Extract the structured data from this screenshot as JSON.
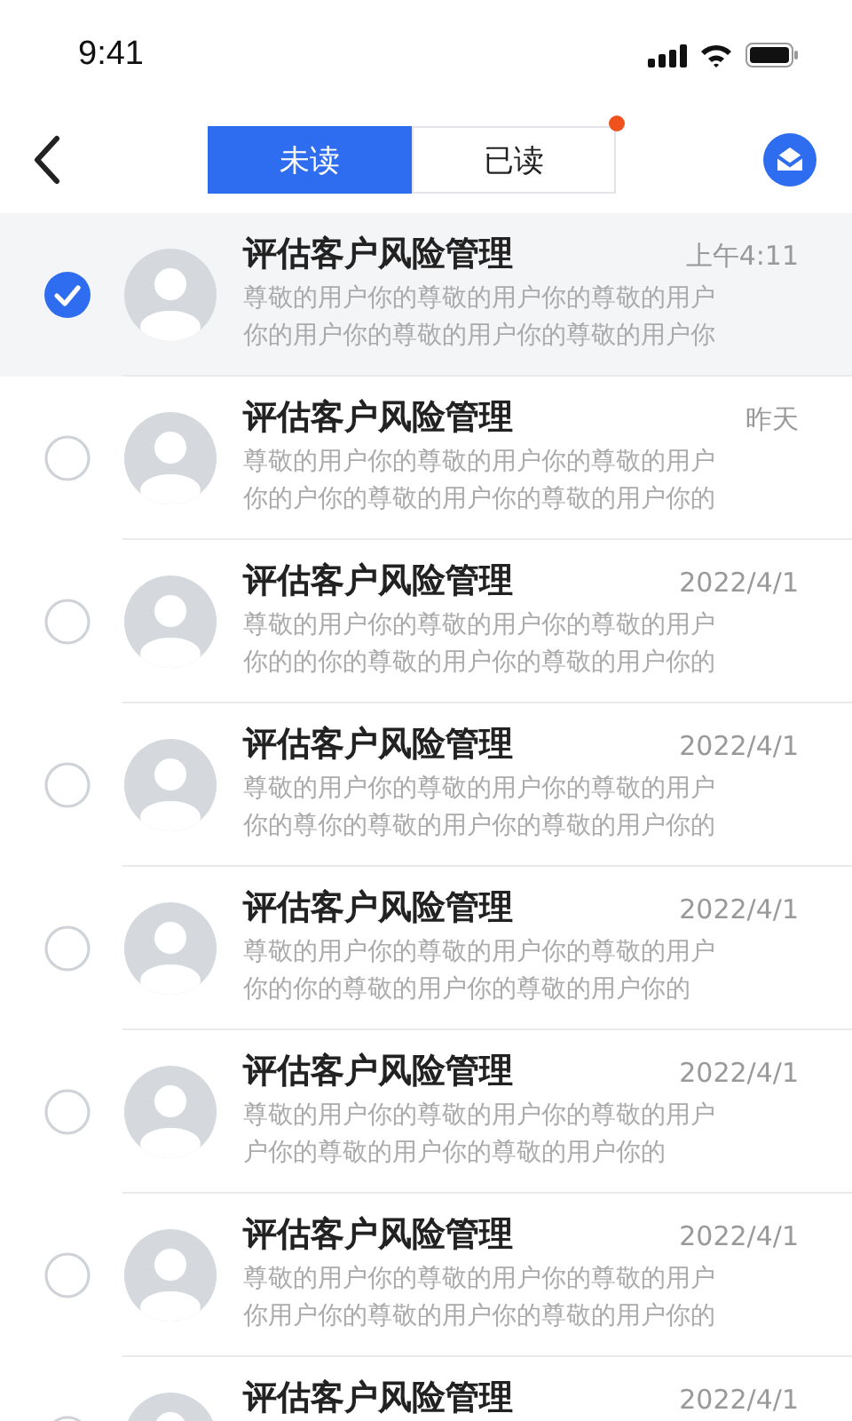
{
  "status_bar": {
    "time": "9:41"
  },
  "nav": {
    "tabs": [
      {
        "label": "未读",
        "selected": true,
        "badge": false
      },
      {
        "label": "已读",
        "selected": false,
        "badge": true
      }
    ]
  },
  "messages": [
    {
      "title": "评估客户风险管理",
      "time": "上午4:11",
      "lines": [
        "尊敬的用户你的尊敬的用户你的尊敬的用户",
        "你的用户你的尊敬的用户你的尊敬的用户你"
      ],
      "checked": true
    },
    {
      "title": "评估客户风险管理",
      "time": "昨天",
      "lines": [
        "尊敬的用户你的尊敬的用户你的尊敬的用户",
        "你的户你的尊敬的用户你的尊敬的用户你的"
      ],
      "checked": false
    },
    {
      "title": "评估客户风险管理",
      "time": "2022/4/1",
      "lines": [
        "尊敬的用户你的尊敬的用户你的尊敬的用户",
        "你的的你的尊敬的用户你的尊敬的用户你的"
      ],
      "checked": false
    },
    {
      "title": "评估客户风险管理",
      "time": "2022/4/1",
      "lines": [
        "尊敬的用户你的尊敬的用户你的尊敬的用户",
        "你的尊你的尊敬的用户你的尊敬的用户你的"
      ],
      "checked": false
    },
    {
      "title": "评估客户风险管理",
      "time": "2022/4/1",
      "lines": [
        "尊敬的用户你的尊敬的用户你的尊敬的用户",
        "你的你的尊敬的用户你的尊敬的用户你的"
      ],
      "checked": false
    },
    {
      "title": "评估客户风险管理",
      "time": "2022/4/1",
      "lines": [
        "尊敬的用户你的尊敬的用户你的尊敬的用户",
        "户你的尊敬的用户你的尊敬的用户你的"
      ],
      "checked": false
    },
    {
      "title": "评估客户风险管理",
      "time": "2022/4/1",
      "lines": [
        "尊敬的用户你的尊敬的用户你的尊敬的用户",
        "你用户你的尊敬的用户你的尊敬的用户你的"
      ],
      "checked": false
    },
    {
      "title": "评估客户风险管理",
      "time": "2022/4/1",
      "checked": false
    }
  ]
}
